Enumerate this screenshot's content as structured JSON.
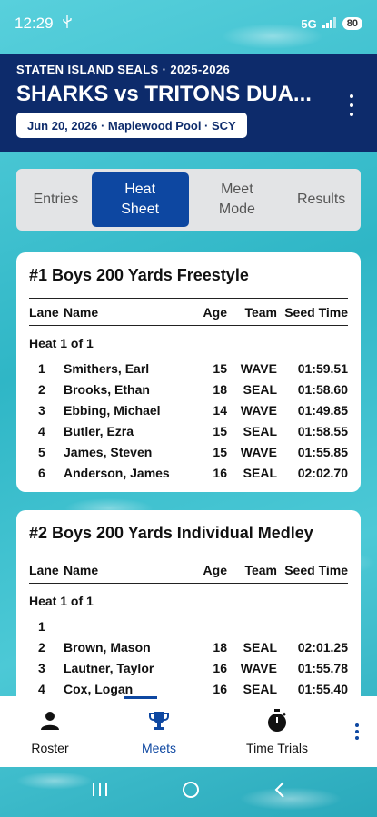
{
  "status_bar": {
    "time": "12:29",
    "network": "5G",
    "battery": "80"
  },
  "header": {
    "org_season": "STATEN ISLAND SEALS · 2025-2026",
    "meet_title": "SHARKS vs TRITONS DUA...",
    "meet_info": "Jun 20, 2026 · Maplewood Pool · SCY",
    "menu_icon": "more-vertical-icon"
  },
  "tabs": [
    {
      "label": "Entries",
      "active": false
    },
    {
      "label": "Heat Sheet",
      "active": true
    },
    {
      "label": "Meet Mode",
      "active": false
    },
    {
      "label": "Results",
      "active": false
    }
  ],
  "columns": {
    "lane": "Lane",
    "name": "Name",
    "age": "Age",
    "team": "Team",
    "seed": "Seed Time"
  },
  "events": [
    {
      "title": "#1 Boys 200 Yards Freestyle",
      "heat": "Heat 1 of 1",
      "rows": [
        {
          "lane": "1",
          "name": "Smithers, Earl",
          "age": "15",
          "team": "WAVE",
          "seed": "01:59.51"
        },
        {
          "lane": "2",
          "name": "Brooks, Ethan",
          "age": "18",
          "team": "SEAL",
          "seed": "01:58.60"
        },
        {
          "lane": "3",
          "name": "Ebbing, Michael",
          "age": "14",
          "team": "WAVE",
          "seed": "01:49.85"
        },
        {
          "lane": "4",
          "name": "Butler, Ezra",
          "age": "15",
          "team": "SEAL",
          "seed": "01:58.55"
        },
        {
          "lane": "5",
          "name": "James, Steven",
          "age": "15",
          "team": "WAVE",
          "seed": "01:55.85"
        },
        {
          "lane": "6",
          "name": "Anderson, James",
          "age": "16",
          "team": "SEAL",
          "seed": "02:02.70"
        }
      ]
    },
    {
      "title": "#2 Boys 200 Yards Individual Medley",
      "heat": "Heat 1 of 1",
      "rows": [
        {
          "lane": "1",
          "name": "",
          "age": "",
          "team": "",
          "seed": ""
        },
        {
          "lane": "2",
          "name": "Brown, Mason",
          "age": "18",
          "team": "SEAL",
          "seed": "02:01.25"
        },
        {
          "lane": "3",
          "name": "Lautner, Taylor",
          "age": "16",
          "team": "WAVE",
          "seed": "01:55.78"
        },
        {
          "lane": "4",
          "name": "Cox, Logan",
          "age": "16",
          "team": "SEAL",
          "seed": "01:55.40"
        }
      ]
    }
  ],
  "bottom_nav": {
    "roster": "Roster",
    "meets": "Meets",
    "time_trials": "Time Trials"
  },
  "colors": {
    "header_bg": "#0d2b6b",
    "accent": "#0d47a1",
    "tab_bg": "#e3e4e6"
  }
}
